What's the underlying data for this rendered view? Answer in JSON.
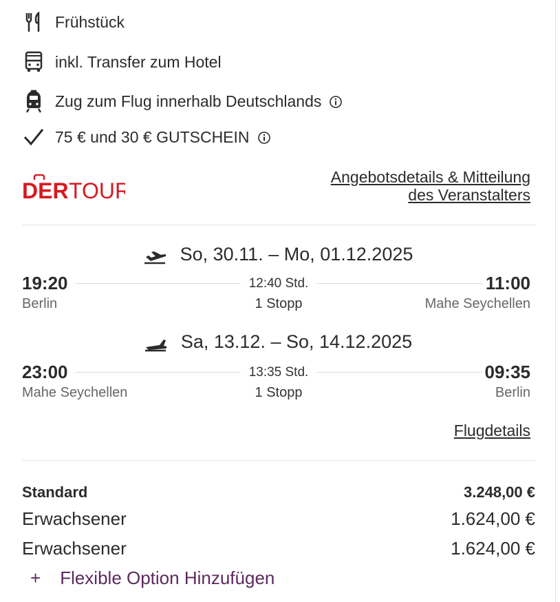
{
  "features": [
    {
      "icon": "fork-knife-icon",
      "label": "Frühstück"
    },
    {
      "icon": "bus-icon",
      "label": "inkl. Transfer zum Hotel"
    },
    {
      "icon": "train-icon",
      "label": "Zug zum Flug innerhalb Deutschlands"
    },
    {
      "icon": "checkmark-icon",
      "label": "75 € und 30 € GUTSCHEIN"
    }
  ],
  "brand": {
    "logo_text_left": "DER",
    "logo_text_right": "TOUR",
    "color": "#d71920"
  },
  "offer_link": {
    "line1": "Angebotsdetails & Mitteilung",
    "line2": "des Veranstalters"
  },
  "outbound": {
    "date": "So, 30.11. – Mo, 01.12.2025",
    "dep_time": "19:20",
    "dep_city": "Berlin",
    "duration": "12:40 Std.",
    "stops": "1 Stopp",
    "arr_time": "11:00",
    "arr_city": "Mahe Seychellen"
  },
  "return": {
    "date": "Sa, 13.12. – So, 14.12.2025",
    "dep_time": "23:00",
    "dep_city": "Mahe Seychellen",
    "duration": "13:35 Std.",
    "stops": "1 Stopp",
    "arr_time": "09:35",
    "arr_city": "Berlin"
  },
  "flight_details_link": "Flugdetails",
  "pricing": {
    "standard_label": "Standard",
    "standard_total": "3.248,00 €",
    "travellers": [
      {
        "label": "Erwachsener",
        "price": "1.624,00 €"
      },
      {
        "label": "Erwachsener",
        "price": "1.624,00 €"
      }
    ]
  },
  "flex_option": {
    "plus": "+",
    "label": "Flexible Option Hinzufügen"
  },
  "colors": {
    "accent": "#5c2a5e",
    "brand": "#d71920"
  }
}
